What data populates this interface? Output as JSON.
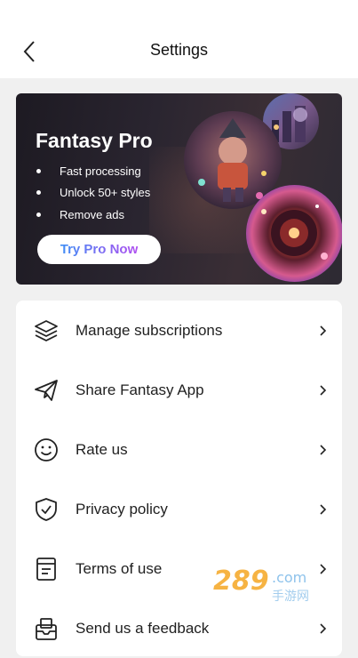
{
  "header": {
    "title": "Settings"
  },
  "banner": {
    "title": "Fantasy Pro",
    "features": [
      "Fast processing",
      "Unlock 50+ styles",
      "Remove ads"
    ],
    "cta_label": "Try Pro Now"
  },
  "menu": {
    "items": [
      {
        "label": "Manage subscriptions",
        "icon": "layers-icon"
      },
      {
        "label": "Share Fantasy App",
        "icon": "paper-plane-icon"
      },
      {
        "label": "Rate us",
        "icon": "smiley-icon"
      },
      {
        "label": "Privacy policy",
        "icon": "shield-check-icon"
      },
      {
        "label": "Terms of use",
        "icon": "document-icon"
      },
      {
        "label": "Send us a feedback",
        "icon": "mail-tray-icon"
      }
    ]
  },
  "watermark": {
    "text": "289.com 手游网"
  },
  "colors": {
    "background": "#f0f0f0",
    "card": "#ffffff",
    "cta_gradient_start": "#3f8ef5",
    "cta_gradient_end": "#b04ff0"
  }
}
